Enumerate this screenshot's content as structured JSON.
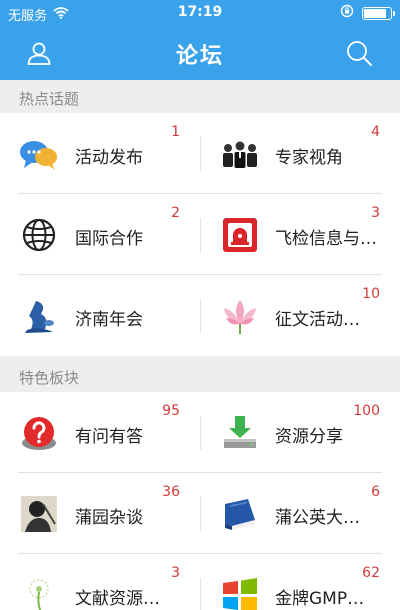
{
  "status_bar": {
    "carrier": "无服务",
    "time": "17:19",
    "battery_level": 0.85
  },
  "nav": {
    "title": "论坛",
    "user_icon": "user-icon",
    "search_icon": "search-icon"
  },
  "sections": [
    {
      "title": "热点话题",
      "items": [
        {
          "label": "活动发布",
          "count": "1",
          "icon": "chat-bubbles-icon"
        },
        {
          "label": "专家视角",
          "count": "4",
          "icon": "experts-icon"
        },
        {
          "label": "国际合作",
          "count": "2",
          "icon": "globe-icon"
        },
        {
          "label": "飞检信息与…",
          "count": "3",
          "icon": "alarm-icon"
        },
        {
          "label": "济南年会",
          "count": "",
          "icon": "sculpture-icon"
        },
        {
          "label": "征文活动…",
          "count": "10",
          "icon": "lotus-icon"
        }
      ]
    },
    {
      "title": "特色板块",
      "items": [
        {
          "label": "有问有答",
          "count": "95",
          "icon": "question-icon"
        },
        {
          "label": "资源分享",
          "count": "100",
          "icon": "download-icon"
        },
        {
          "label": "蒲园杂谈",
          "count": "36",
          "icon": "portrait-icon"
        },
        {
          "label": "蒲公英大…",
          "count": "6",
          "icon": "book-icon"
        },
        {
          "label": "文献资源…",
          "count": "3",
          "icon": "dandelion-icon"
        },
        {
          "label": "金牌GMP…",
          "count": "62",
          "icon": "windows-icon"
        }
      ]
    }
  ]
}
